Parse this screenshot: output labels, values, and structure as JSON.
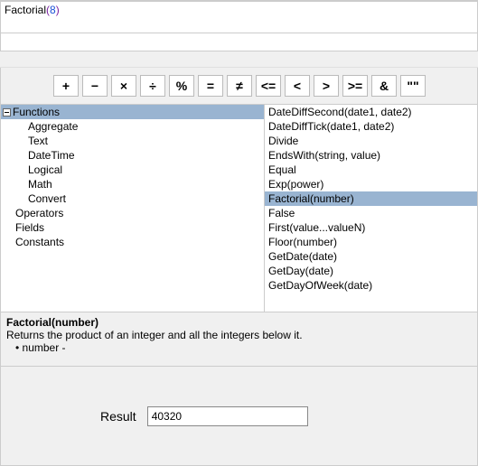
{
  "expression": {
    "fn": "Factorial",
    "open": "(",
    "arg": "8",
    "close": ")"
  },
  "toolbar": {
    "ops": [
      "+",
      "−",
      "×",
      "÷",
      "%",
      "=",
      "≠",
      "<=",
      "<",
      ">",
      ">=",
      "&",
      "\"\""
    ]
  },
  "tree": {
    "root": "Functions",
    "children": [
      "Aggregate",
      "Text",
      "DateTime",
      "Logical",
      "Math",
      "Convert"
    ],
    "siblings": [
      "Operators",
      "Fields",
      "Constants"
    ]
  },
  "functions": [
    "DateDiffSecond(date1, date2)",
    "DateDiffTick(date1, date2)",
    "Divide",
    "EndsWith(string, value)",
    "Equal",
    "Exp(power)",
    "Factorial(number)",
    "False",
    "First(value...valueN)",
    "Floor(number)",
    "GetDate(date)",
    "GetDay(date)",
    "GetDayOfWeek(date)"
  ],
  "selected_function_index": 6,
  "description": {
    "title": "Factorial(number)",
    "body": "Returns the product of an integer and all the integers below it.",
    "param": "• number -"
  },
  "result": {
    "label": "Result",
    "value": "40320"
  }
}
